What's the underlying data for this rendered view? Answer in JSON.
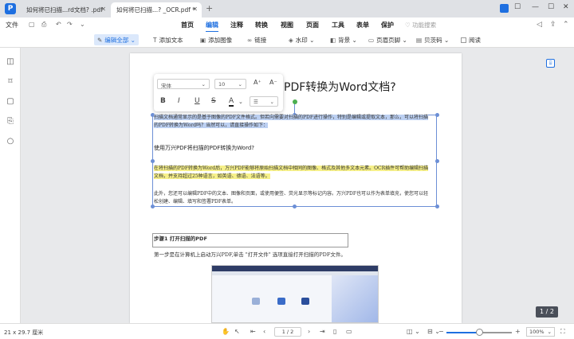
{
  "titlebar": {
    "tabs": [
      {
        "label": "如何将已扫描...rd文档? .pdf",
        "active": false
      },
      {
        "label": "如何将已扫描...? _OCR.pdf *",
        "active": true
      }
    ],
    "add_tab": "+"
  },
  "menubar": {
    "file": "文件",
    "items": [
      "首页",
      "编辑",
      "注释",
      "转换",
      "视图",
      "页面",
      "工具",
      "表单",
      "保护"
    ],
    "active": "编辑",
    "search_placeholder": "功能搜索"
  },
  "toolbar": {
    "edit_all": "编辑全部",
    "add_text": "添加文本",
    "add_image": "添加图像",
    "link": "链接",
    "watermark": "水印",
    "background": "背景",
    "header_footer": "页眉页脚",
    "bates": "贝茨码",
    "read_mode": "阅读"
  },
  "float_toolbar": {
    "font": "宋体",
    "size": "10",
    "bold": "B",
    "italic": "I",
    "underline": "U",
    "strike": "S",
    "color": "A",
    "font_up": "A⁺",
    "font_down": "A⁻"
  },
  "document": {
    "title_prefix": "",
    "title_main": "PDF转换为Word文档?",
    "para1": "扫描文档通常显示的是基于图像的PDF文件格式。但若向需要对扫描的PDF进行操作，特别是编辑或提取文本，那么，可以将扫描的PDF转换为Word吗？当然可以，请直接操作如下：",
    "para2": "使用万兴PDF将扫描的PDF转换为Word?",
    "para3": "在将扫描的PDF转换为Word后，万兴PDF能够将原始扫描文档中相同的图像、格式及其他多文本元素。OCR插件可帮助编辑扫描文档，并支持超过25种语言，如英语、德语、法语等。",
    "para4": "此外，您还可以编辑PDF中的文本、图像和页面，或使用便签、荧光显示等标记内容。万兴PDF也可以作为表单填充，使您可以轻松创建、编辑、填写和签署PDF表单。",
    "step_title": "步骤1 打开扫描的PDF",
    "step_text": "第一步是在计算机上启动万兴PDF,单击 \"打开文件\" 选项直接打开扫描的PDF文件。"
  },
  "page_indicator": "1 / 2",
  "statusbar": {
    "dimensions": "21 x 29.7 厘米",
    "page_field": "1 / 2",
    "zoom": "100%",
    "zoom_level": 0.5
  }
}
